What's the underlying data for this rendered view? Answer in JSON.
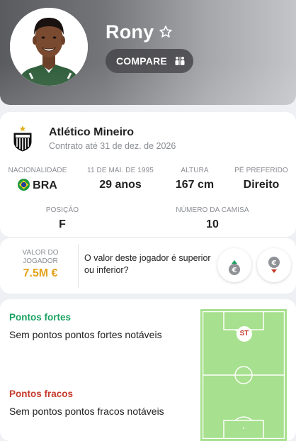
{
  "player": {
    "name": "Rony",
    "compare_label": "COMPARE"
  },
  "club": {
    "name": "Atlético Mineiro",
    "contract": "Contrato até 31 de dez. de 2026"
  },
  "details": {
    "nationality": {
      "label": "NACIONALIDADE",
      "value": "BRA"
    },
    "birth": {
      "label": "11 DE MAI. DE 1995",
      "value": "29 anos"
    },
    "height": {
      "label": "ALTURA",
      "value": "167 cm"
    },
    "foot": {
      "label": "PÉ PREFERIDO",
      "value": "Direito"
    },
    "position": {
      "label": "POSIÇÃO",
      "value": "F"
    },
    "shirt": {
      "label": "NÚMERO DA CAMISA",
      "value": "10"
    }
  },
  "market_value": {
    "label": "VALOR DO JOGADOR",
    "amount": "7.5M €",
    "question": "O valor deste jogador é superior ou inferior?",
    "currency_symbol": "€"
  },
  "traits": {
    "strengths_title": "Pontos fortes",
    "strengths_text": "Sem pontos pontos fortes notáveis",
    "weaknesses_title": "Pontos fracos",
    "weaknesses_text": "Sem pontos pontos fracos notáveis"
  },
  "pitch": {
    "position_marker": "ST"
  },
  "colors": {
    "value_gold": "#e3a21a",
    "strength_green": "#1aa262",
    "weakness_red": "#c53a2b",
    "pitch_green": "#a7e08e"
  },
  "icons": {
    "favorite": "star-outline-icon",
    "compare": "compare-icon",
    "nationality": "brazil-flag-icon",
    "vote_up": "euro-up-icon",
    "vote_down": "euro-down-icon"
  }
}
